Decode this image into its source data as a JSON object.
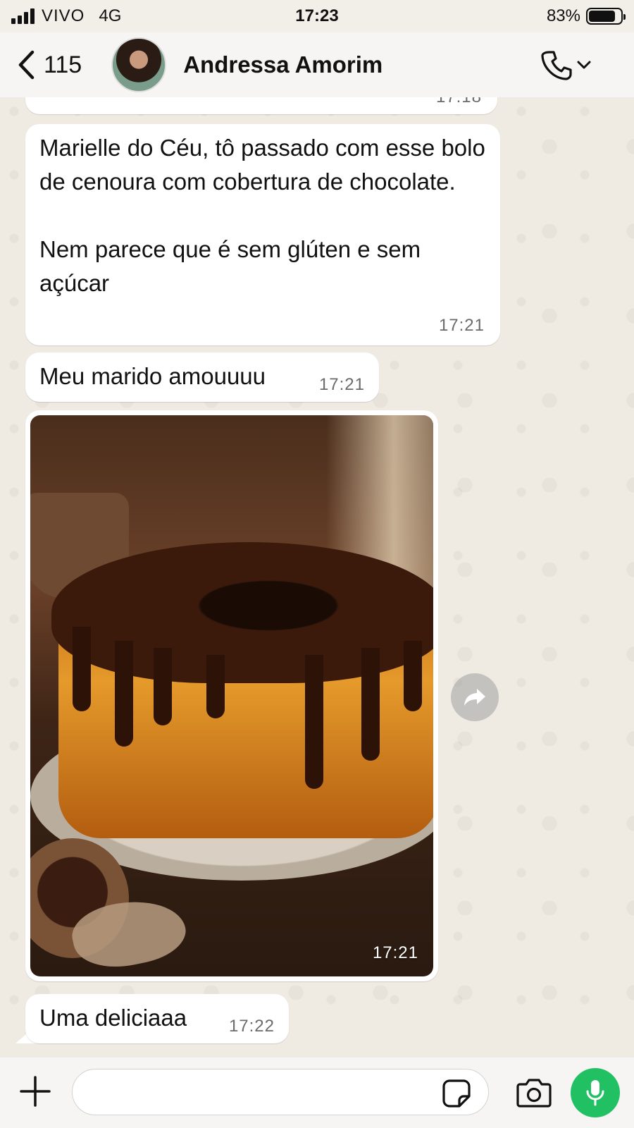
{
  "status_bar": {
    "carrier": "VIVO",
    "network": "4G",
    "time": "17:23",
    "battery_percent": "83%",
    "battery_level": 0.83
  },
  "header": {
    "back_count": "115",
    "contact_name": "Andressa Amorim",
    "icons": [
      "chevron-left-icon",
      "phone-icon",
      "chevron-down-icon"
    ]
  },
  "messages": [
    {
      "type": "text",
      "text": "",
      "time": "17:18"
    },
    {
      "type": "text",
      "text": "Marielle do Céu, tô passado com esse bolo de cenoura com cobertura de chocolate.\n\nNem parece que é sem glúten e sem açúcar",
      "time": "17:21"
    },
    {
      "type": "text",
      "text": "Meu marido amouuuu",
      "time": "17:21"
    },
    {
      "type": "image",
      "time": "17:21"
    },
    {
      "type": "text",
      "text": "Uma deliciaaa",
      "time": "17:22"
    }
  ],
  "input_bar": {
    "placeholder": "",
    "icons": [
      "plus-icon",
      "sticker-icon",
      "camera-icon",
      "microphone-icon"
    ]
  },
  "colors": {
    "accent_green": "#21c063",
    "bubble": "#ffffff",
    "chat_background": "#efeae2"
  }
}
